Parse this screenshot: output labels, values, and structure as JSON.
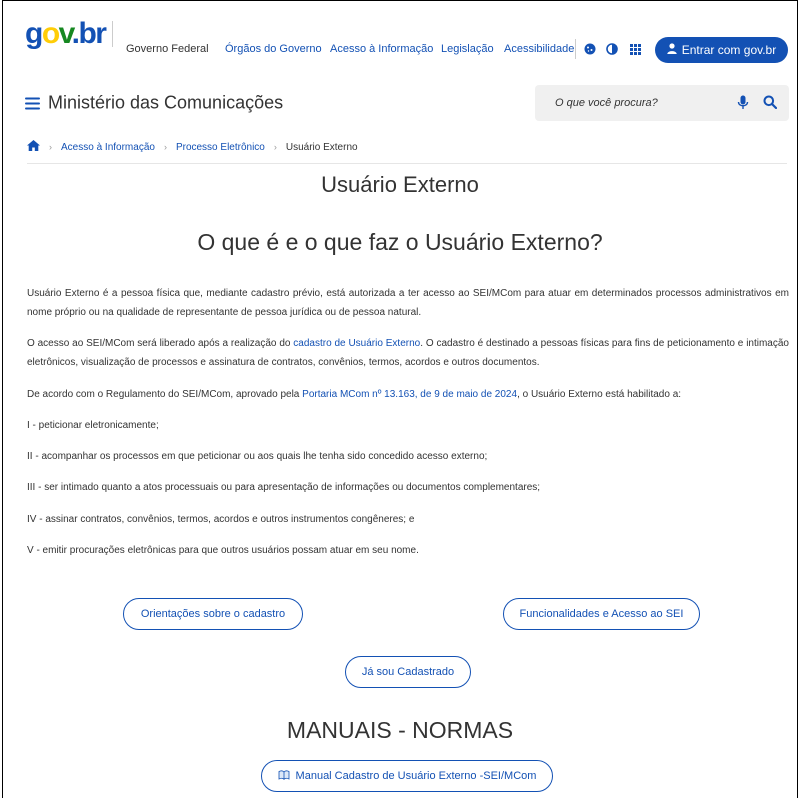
{
  "header": {
    "logo": {
      "g": "g",
      "o": "o",
      "v": "v",
      "dot": ".",
      "br": "br"
    },
    "links": [
      "Governo Federal",
      "Órgãos do Governo",
      "Acesso à Informação",
      "Legislação",
      "Acessibilidade"
    ],
    "login_label": "Entrar com gov.br",
    "site_title": "Ministério das Comunicações",
    "search_placeholder": "O que você procura?"
  },
  "breadcrumb": {
    "items": [
      "Acesso à Informação",
      "Processo Eletrônico"
    ],
    "current": "Usuário Externo"
  },
  "main": {
    "title": "Usuário Externo",
    "section_title": "O que é e o que faz o Usuário Externo?",
    "p1": "Usuário Externo é a pessoa física que, mediante cadastro prévio, está autorizada a ter acesso ao SEI/MCom para atuar em determinados processos administrativos em nome próprio ou na qualidade de representante de pessoa jurídica ou de pessoa natural.",
    "p2_before": "O acesso ao SEI/MCom será liberado após a realização do ",
    "p2_link": "cadastro de Usuário Externo",
    "p2_after": ". O cadastro é destinado a pessoas físicas para fins de peticionamento e intimação eletrônicos, visualização de processos e assinatura de contratos, convênios, termos, acordos e outros documentos.",
    "p3_before": "De acordo com o Regulamento do SEI/MCom, aprovado pela ",
    "p3_link": "Portaria MCom nº 13.163, de 9 de maio de 2024",
    "p3_after": ", o Usuário Externo está habilitado a:",
    "list": [
      "I - peticionar eletronicamente;",
      "II - acompanhar os processos em que peticionar ou aos quais lhe tenha sido concedido acesso externo;",
      "III - ser intimado quanto a atos processuais ou para apresentação de informações ou documentos complementares;",
      "IV - assinar contratos, convênios, termos, acordos e outros instrumentos congêneres; e",
      "V - emitir procurações eletrônicas para que outros usuários possam atuar em seu nome."
    ],
    "buttons": {
      "orientacoes": "Orientações sobre o cadastro",
      "funcionalidades": "Funcionalidades e Acesso ao SEI",
      "cadastrado": "Já sou Cadastrado"
    },
    "manuals_title": "MANUAIS - NORMAS",
    "manual_button": "Manual Cadastro de Usuário Externo -SEI/MCom"
  },
  "colors": {
    "primary": "#1351b4",
    "text": "#333333",
    "search_bg": "#f0f0f0"
  },
  "icons": [
    "home-icon",
    "chevron-right-icon",
    "cookie-icon",
    "contrast-icon",
    "apps-grid-icon",
    "user-icon",
    "menu-icon",
    "microphone-icon",
    "search-icon",
    "book-icon"
  ]
}
